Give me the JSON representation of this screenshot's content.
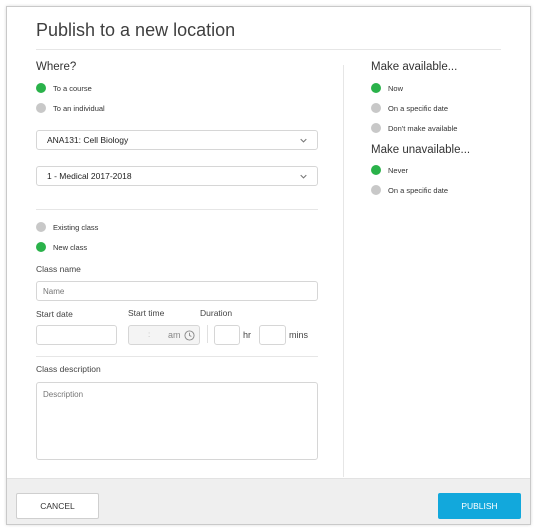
{
  "dialog": {
    "title": "Publish to a new location"
  },
  "where": {
    "heading": "Where?",
    "options": [
      {
        "label": "To a course",
        "selected": true
      },
      {
        "label": "To an individual",
        "selected": false
      }
    ],
    "course_select": "ANA131: Cell Biology",
    "cohort_select": "1 - Medical 2017-2018",
    "class_options": [
      {
        "label": "Existing class",
        "selected": false
      },
      {
        "label": "New class",
        "selected": true
      }
    ]
  },
  "class_form": {
    "name_label": "Class name",
    "name_placeholder": "Name",
    "start_date_label": "Start date",
    "start_time_label": "Start time",
    "time_separator": ":",
    "am_label": "am",
    "duration_label": "Duration",
    "hr_label": "hr",
    "mins_label": "mins",
    "description_label": "Class description",
    "description_placeholder": "Description"
  },
  "availability": {
    "available_heading": "Make available...",
    "available_options": [
      {
        "label": "Now",
        "selected": true
      },
      {
        "label": "On a specific date",
        "selected": false
      },
      {
        "label": "Don't make available",
        "selected": false
      }
    ],
    "unavailable_heading": "Make unavailable...",
    "unavailable_options": [
      {
        "label": "Never",
        "selected": true
      },
      {
        "label": "On a specific date",
        "selected": false
      }
    ]
  },
  "footer": {
    "cancel_label": "CANCEL",
    "publish_label": "PUBLISH"
  },
  "colors": {
    "accent": "#12a8dc",
    "selected_radio": "#2ab24a",
    "unselected_radio": "#c8c8c8"
  },
  "icons": [
    "chevron-down-icon",
    "clock-icon"
  ]
}
